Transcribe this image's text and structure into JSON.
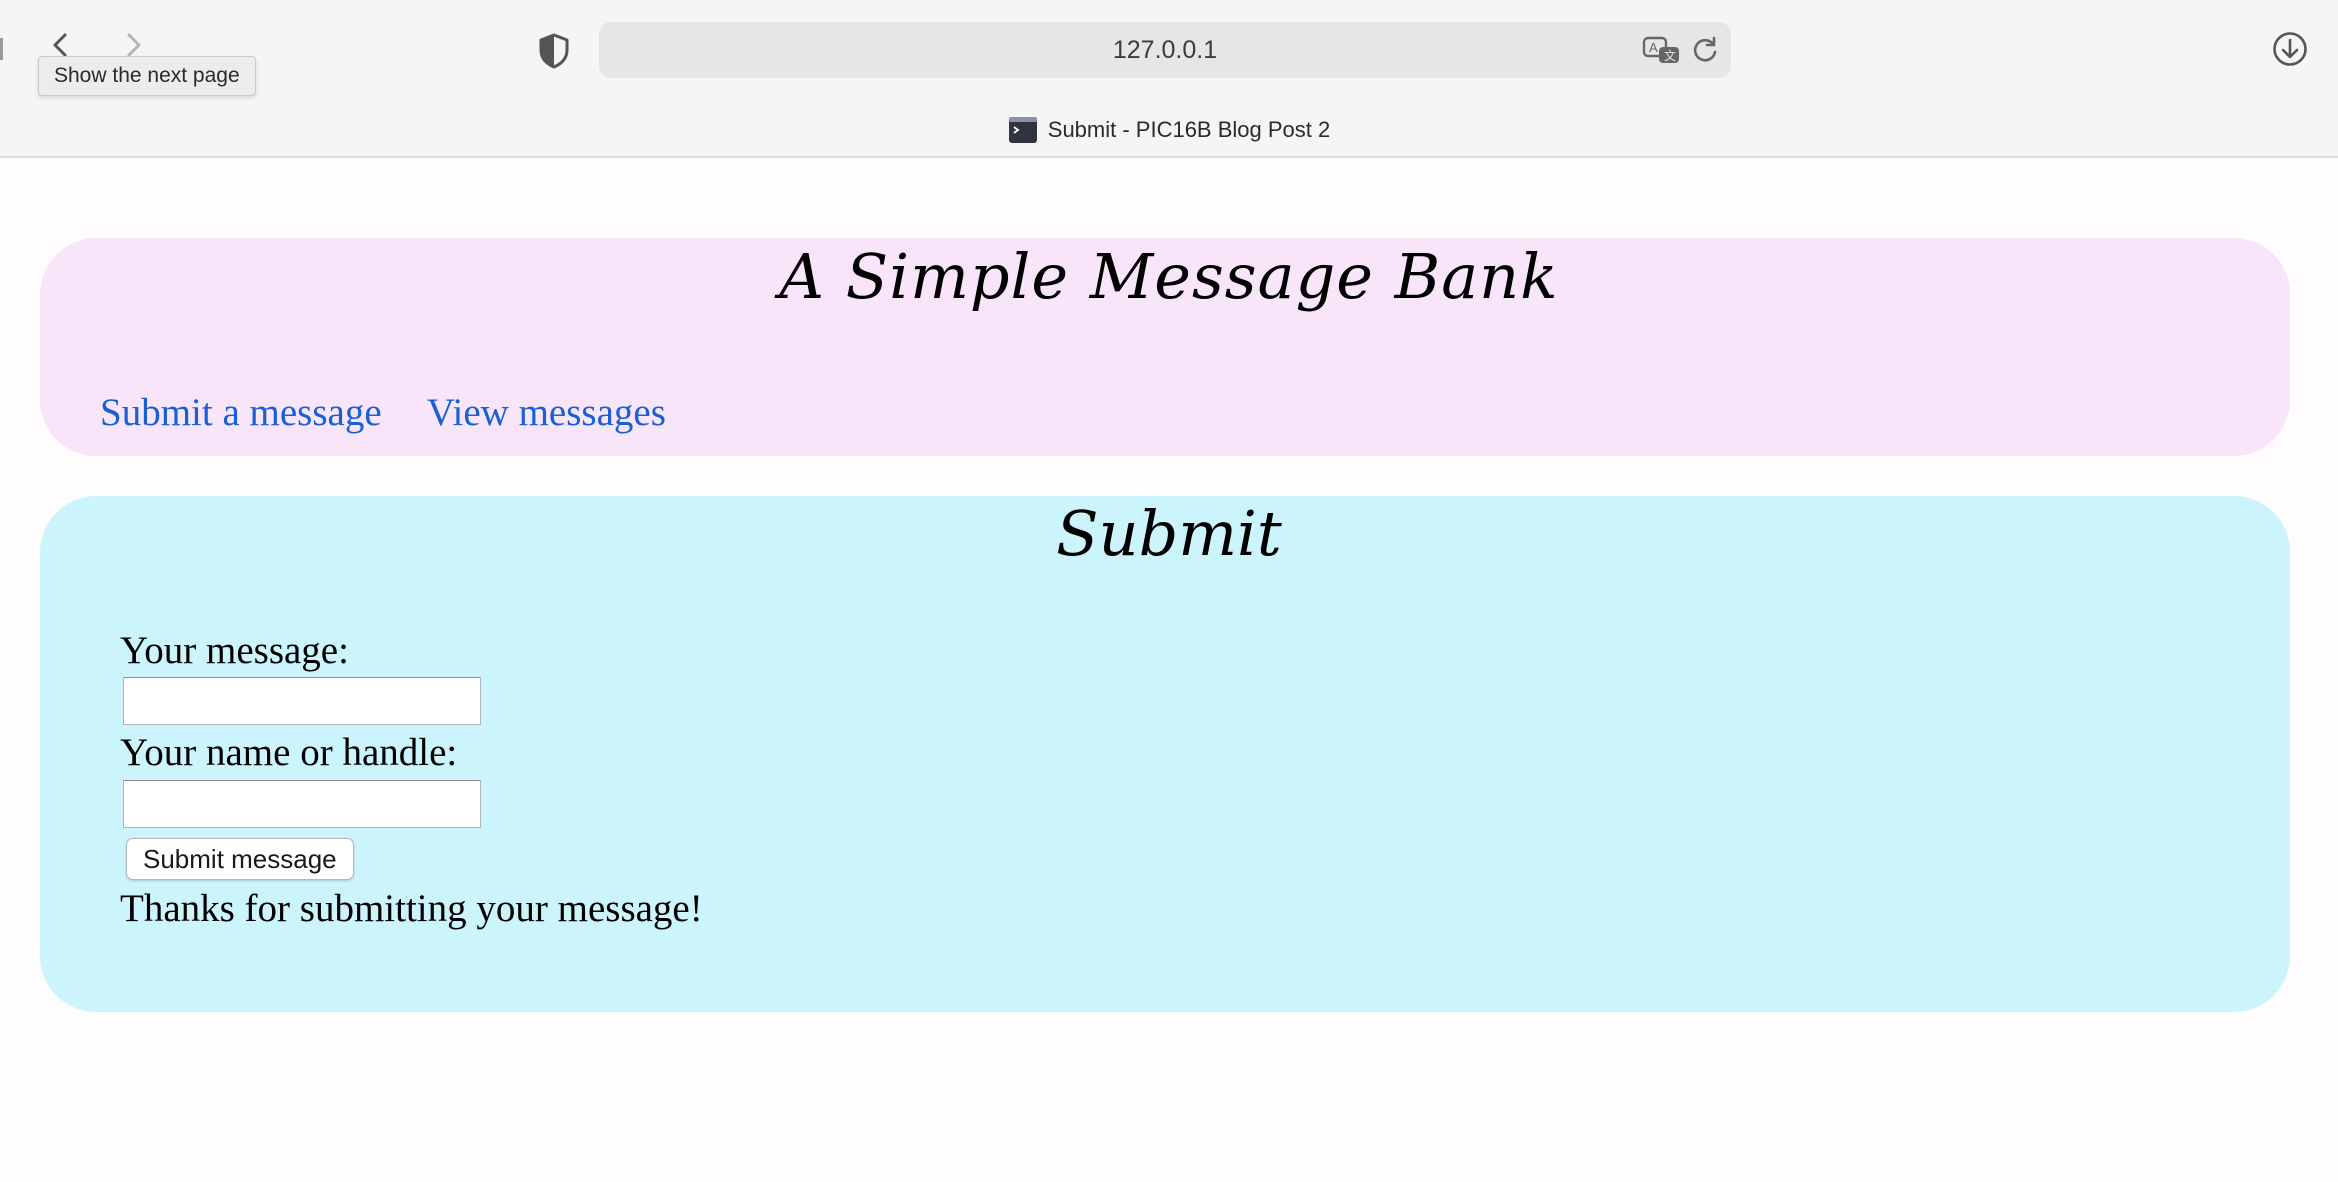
{
  "browser": {
    "url": "127.0.0.1",
    "tab_title": "Submit - PIC16B Blog Post 2",
    "tooltip": "Show the next page"
  },
  "header": {
    "title": "A Simple Message Bank",
    "links": [
      {
        "label": "Submit a message"
      },
      {
        "label": "View messages"
      }
    ]
  },
  "form": {
    "heading": "Submit",
    "message_label": "Your message:",
    "message_value": "",
    "handle_label": "Your name or handle:",
    "handle_value": "",
    "submit_label": "Submit message",
    "confirmation": "Thanks for submitting your message!"
  },
  "colors": {
    "header_bg": "#f8e5f9",
    "main_bg": "#ccf4fd",
    "link": "#1a5fd6"
  }
}
